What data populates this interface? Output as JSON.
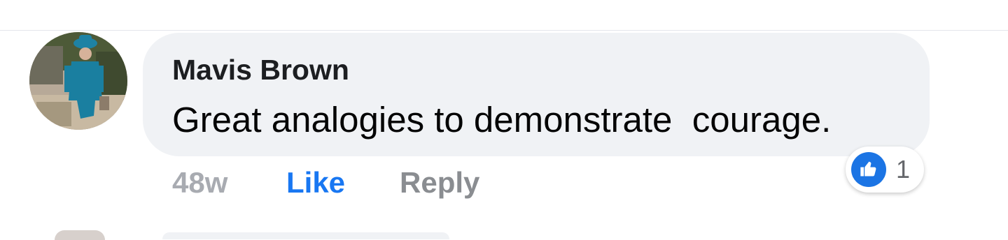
{
  "comment": {
    "author": "Mavis Brown",
    "text": "Great analogies to demonstrate  courage.",
    "time": "48w",
    "like_label": "Like",
    "reply_label": "Reply",
    "reaction_count": "1",
    "reaction_icon": "thumbs-up-icon"
  },
  "colors": {
    "bubble": "#f0f2f5",
    "like_blue": "#1877f2",
    "muted_text": "#8a8d91"
  }
}
